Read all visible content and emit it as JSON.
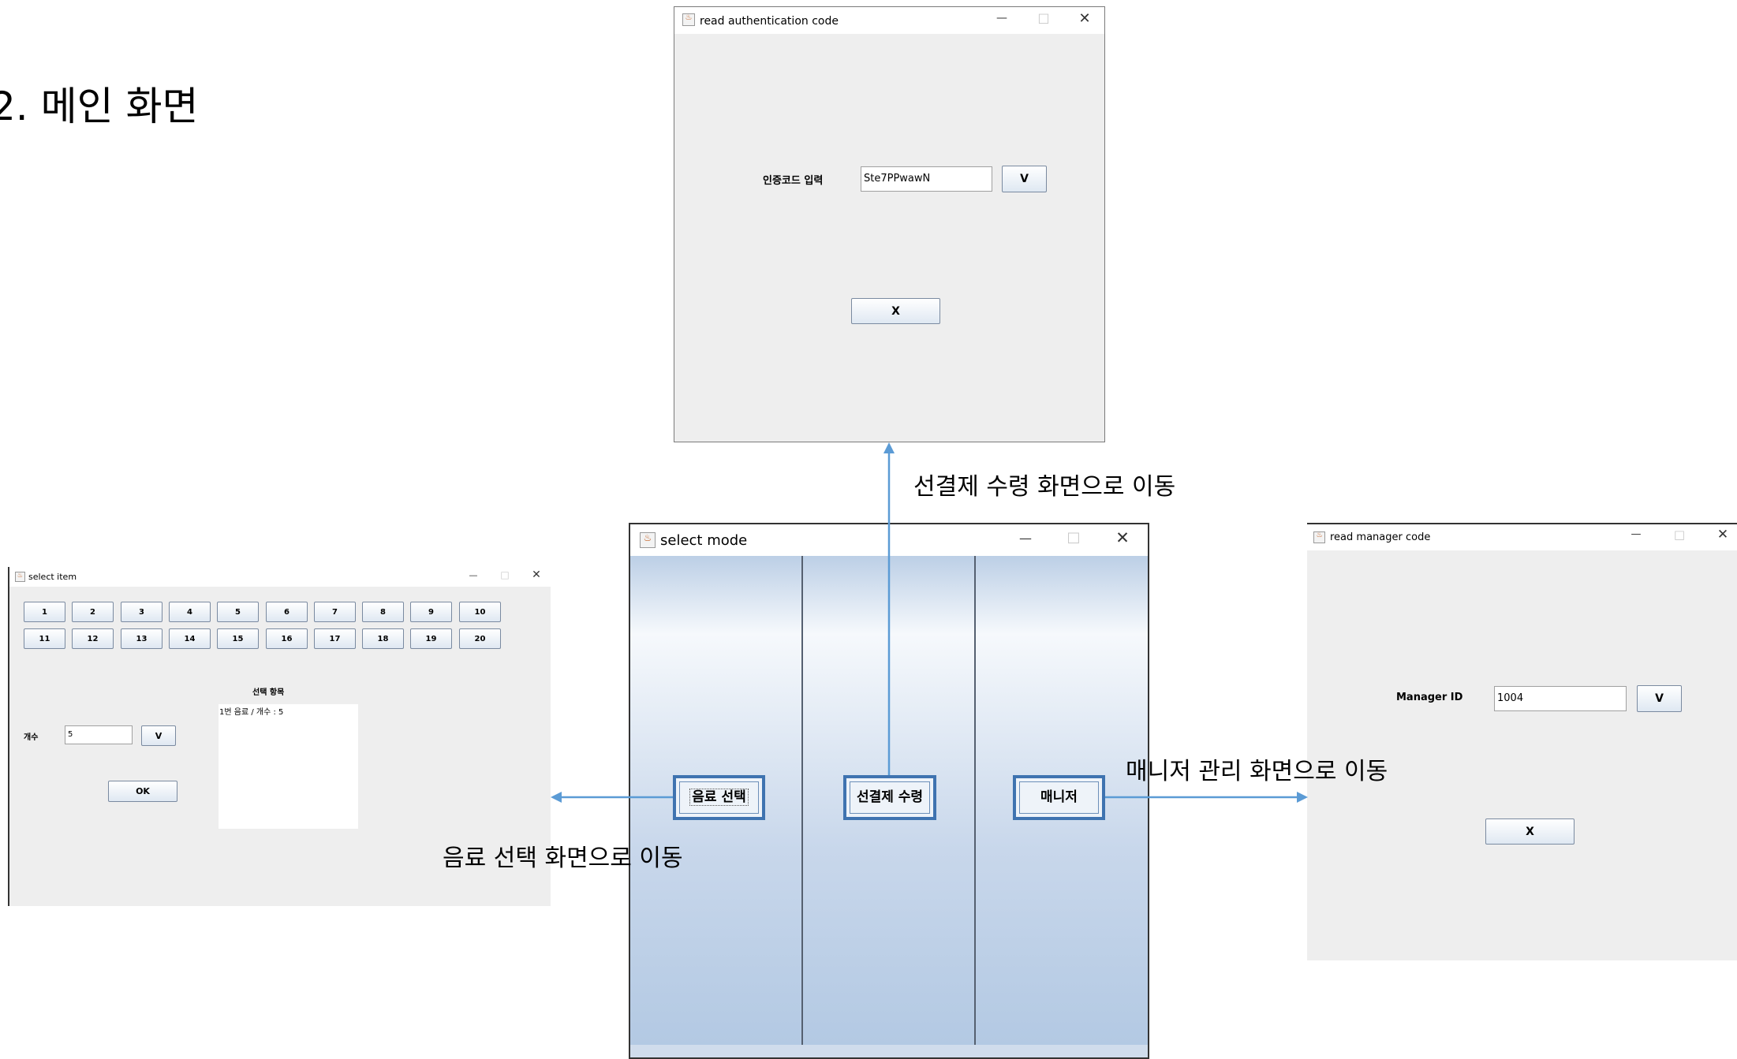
{
  "heading": "2. 메인 화면",
  "auth_window": {
    "title": "read authentication code",
    "label": "인증코드 입력",
    "input_value": "Ste7PPwawN",
    "confirm_label": "V",
    "close_label": "X"
  },
  "mode_window": {
    "title": "select mode",
    "buttons": [
      "음료 선택",
      "선결제 수령",
      "매니저"
    ]
  },
  "item_window": {
    "title": "select item",
    "items_row1": [
      "1",
      "2",
      "3",
      "4",
      "5",
      "6",
      "7",
      "8",
      "9",
      "10"
    ],
    "items_row2": [
      "11",
      "12",
      "13",
      "14",
      "15",
      "16",
      "17",
      "18",
      "19",
      "20"
    ],
    "selected_title": "선택 항목",
    "selected_entry": "1번 음료 / 개수 : 5",
    "count_label": "개수",
    "count_value": "5",
    "confirm_label": "V",
    "ok_label": "OK"
  },
  "manager_window": {
    "title": "read manager code",
    "label": "Manager ID",
    "input_value": "1004",
    "confirm_label": "V",
    "close_label": "X"
  },
  "window_controls": {
    "minimize": "—",
    "maximize": "□",
    "close": "✕"
  },
  "captions": {
    "to_prepay": "선결제 수령 화면으로 이동",
    "to_manager": "매니저 관리 화면으로 이동",
    "to_drink": "음료 선택 화면으로 이동"
  },
  "colors": {
    "arrow": "#5b9bd5",
    "mode_button_border": "#3f73b0"
  }
}
